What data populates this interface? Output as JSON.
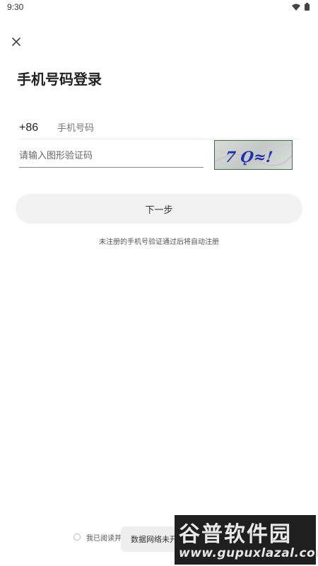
{
  "status_bar": {
    "time": "9:30",
    "icons": [
      "wifi-icon",
      "battery-icon"
    ]
  },
  "header": {
    "close_icon": "close-icon",
    "title": "手机号码登录"
  },
  "form": {
    "country_code": "+86",
    "phone_placeholder": "手机号码",
    "captcha_placeholder": "请输入图形验证码",
    "captcha_text": "7 Ǫ≈!"
  },
  "next_button_label": "下一步",
  "hint": "未注册的手机号验证通过后将自动注册",
  "agreement_text": "我已阅读并",
  "toast": "数据网络未开",
  "watermark": {
    "line1": "谷普软件园",
    "line2": "www.gupuxlazal.com"
  },
  "colors": {
    "accent_captcha_text": "#1f2fb3",
    "button_bg": "#f2f2f2"
  }
}
